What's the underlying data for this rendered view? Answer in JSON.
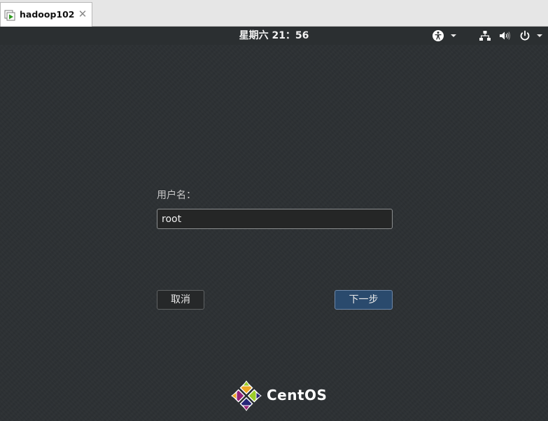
{
  "vm_tab": {
    "title": "hadoop102",
    "close_glyph": "✕",
    "icon": "vm-play-icon"
  },
  "topbar": {
    "clock": "星期六  21：56",
    "icons": [
      "accessibility-icon",
      "chevron-down-icon",
      "network-icon",
      "volume-icon",
      "power-icon",
      "chevron-down-icon"
    ]
  },
  "login": {
    "username_label": "用户名：",
    "username_value": "root",
    "cancel_label": "取消",
    "next_label": "下一步"
  },
  "branding": {
    "logo_text": "CentOS",
    "colors": {
      "yellow": "#efa724",
      "green": "#9ccd2a",
      "blue": "#262577",
      "purple": "#932279"
    }
  }
}
